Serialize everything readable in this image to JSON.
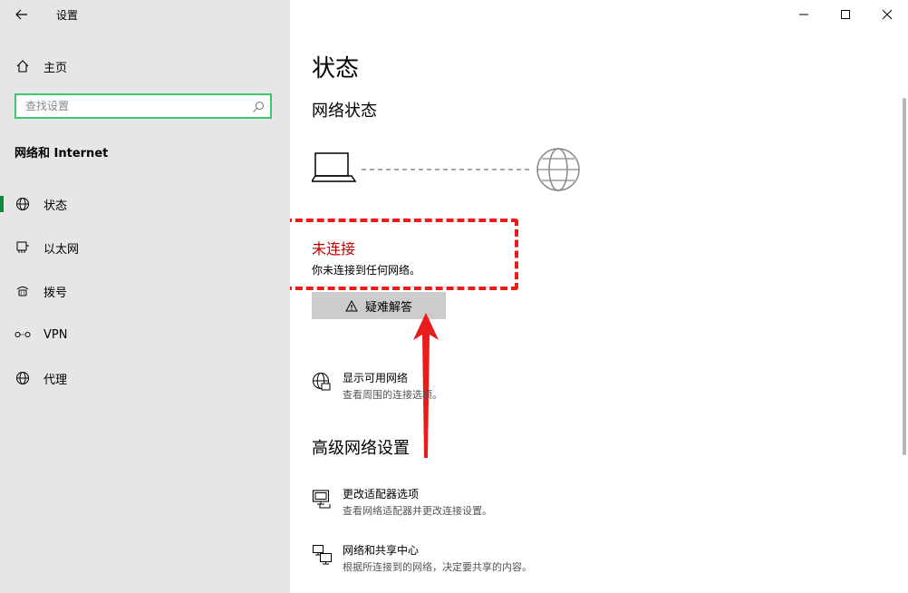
{
  "window": {
    "title": "设置",
    "controls": {
      "minimize": "minimize-icon",
      "maximize": "maximize-icon",
      "close": "close-icon"
    }
  },
  "sidebar": {
    "home_label": "主页",
    "search_placeholder": "查找设置",
    "category": "网络和 Internet",
    "items": [
      {
        "label": "状态",
        "icon": "status-globe-icon",
        "selected": true
      },
      {
        "label": "以太网",
        "icon": "ethernet-icon"
      },
      {
        "label": "拨号",
        "icon": "dialup-icon"
      },
      {
        "label": "VPN",
        "icon": "vpn-icon"
      },
      {
        "label": "代理",
        "icon": "proxy-globe-icon"
      }
    ],
    "selected_color": "#10893e",
    "search_border_color": "#3cc76d"
  },
  "main": {
    "page_title": "状态",
    "network_status_heading": "网络状态",
    "status_title": "未连接",
    "status_desc": "你未连接到任何网络。",
    "troubleshoot_label": "疑难解答",
    "show_networks": {
      "title": "显示可用网络",
      "desc": "查看周围的连接选项。"
    },
    "advanced_heading": "高级网络设置",
    "adapter_options": {
      "title": "更改适配器选项",
      "desc": "查看网络适配器并更改连接设置。"
    },
    "sharing_center": {
      "title": "网络和共享中心",
      "desc": "根据所连接到的网络，决定要共享的内容。"
    },
    "status_color": "#c00000",
    "annotation_color": "#ea1b1b"
  }
}
